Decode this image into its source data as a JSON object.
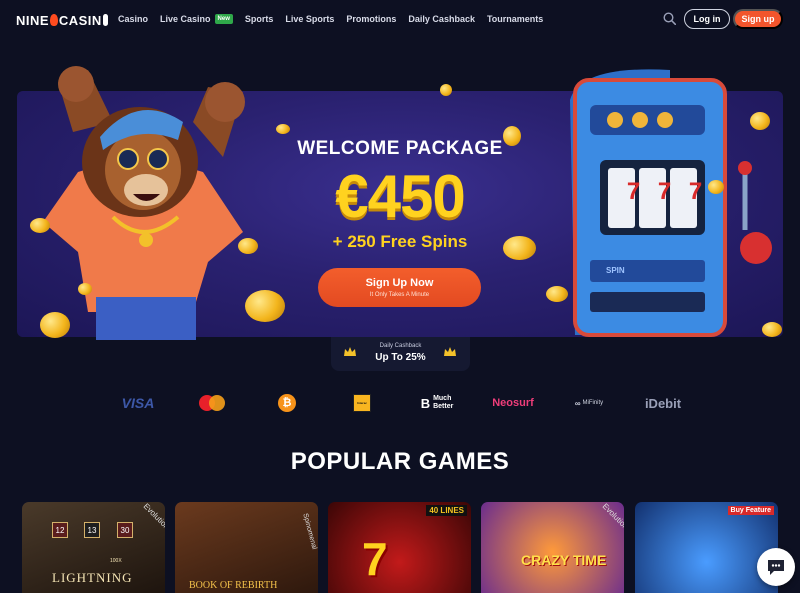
{
  "header": {
    "logo_left": "NINE",
    "logo_right": "CASIN",
    "nav": [
      {
        "label": "Casino"
      },
      {
        "label": "Live Casino",
        "badge": "New"
      },
      {
        "label": "Sports"
      },
      {
        "label": "Live Sports"
      },
      {
        "label": "Promotions"
      },
      {
        "label": "Daily Cashback"
      },
      {
        "label": "Tournaments"
      }
    ],
    "login_label": "Log in",
    "signup_label": "Sign up"
  },
  "hero": {
    "title": "WELCOME PACKAGE",
    "amount": "€450",
    "spins": "+ 250 Free Spins",
    "cta_label": "Sign Up Now",
    "cta_sub": "It Only Takes A Minute",
    "slot_label": "SPIN",
    "reels": [
      "7",
      "7",
      "7"
    ]
  },
  "cashback": {
    "subtitle": "Daily Cashback",
    "value": "Up To 25%"
  },
  "payments": [
    {
      "name": "VISA"
    },
    {
      "name": "Mastercard"
    },
    {
      "name": "Bitcoin"
    },
    {
      "name": "Interac"
    },
    {
      "name_line1": "Much",
      "name_line2": "Better"
    },
    {
      "name": "Neosurf"
    },
    {
      "name": "MiFinity"
    },
    {
      "name": "iDebit"
    }
  ],
  "games_title": "POPULAR GAMES",
  "games": [
    {
      "title": "LIGHTNING",
      "provider": "Evolution",
      "numbers": [
        "12",
        "13",
        "30"
      ],
      "mult": "100X"
    },
    {
      "title": "BOOK OF REBIRTH",
      "provider": "Spinomenal"
    },
    {
      "badge": "40 LINES",
      "symbol": "7"
    },
    {
      "title": "CRAZY TIME",
      "provider": "Evolution"
    },
    {
      "badge": "Buy Feature"
    }
  ],
  "colors": {
    "background": "#0d1022",
    "accent": "#f2552c",
    "gold": "#ffd21f",
    "new_badge": "#2fa84a"
  }
}
